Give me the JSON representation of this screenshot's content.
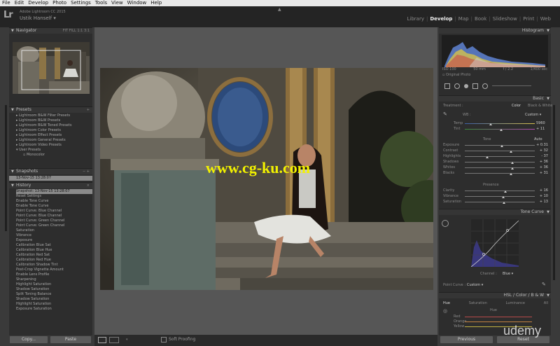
{
  "menu": [
    "File",
    "Edit",
    "Develop",
    "Photo",
    "Settings",
    "Tools",
    "View",
    "Window",
    "Help"
  ],
  "identity": {
    "logo": "Lr",
    "product": "Adobe Lightroom CC 2015",
    "user": "Ustik Hanself"
  },
  "modules": [
    "Library",
    "Develop",
    "Map",
    "Book",
    "Slideshow",
    "Print",
    "Web"
  ],
  "active_module": "Develop",
  "navigator": {
    "title": "Navigator",
    "zoom_opts": [
      "FIT",
      "FILL",
      "1:1",
      "3:1"
    ]
  },
  "presets": {
    "title": "Presets",
    "items": [
      "Lightroom B&W Filter Presets",
      "Lightroom B&W Presets",
      "Lightroom B&W Toned Presets",
      "Lightroom Color Presets",
      "Lightroom Effect Presets",
      "Lightroom General Presets",
      "Lightroom Video Presets",
      "User Presets"
    ],
    "sub": "Monocolor"
  },
  "snapshots": {
    "title": "Snapshots",
    "item": "13-Nov-15 13:28:07"
  },
  "history": {
    "title": "History",
    "items": [
      {
        "label": "Snapshot: 13-Nov-15 13:28:07",
        "val": ""
      },
      {
        "label": "Reset Settings",
        "val": ""
      },
      {
        "label": "Enable Tone Curve",
        "val": ""
      },
      {
        "label": "Enable Tone Curve",
        "val": ""
      },
      {
        "label": "Point Curve: Blue Channel",
        "val": ""
      },
      {
        "label": "Point Curve: Blue Channel",
        "val": ""
      },
      {
        "label": "Point Curve: Green Channel",
        "val": ""
      },
      {
        "label": "Point Curve: Green Channel",
        "val": ""
      },
      {
        "label": "Saturation",
        "val": ""
      },
      {
        "label": "Vibrance",
        "val": ""
      },
      {
        "label": "Exposure",
        "val": ""
      },
      {
        "label": "Calibration Blue Sat",
        "val": ""
      },
      {
        "label": "Calibration Blue Hue",
        "val": ""
      },
      {
        "label": "Calibration Red Sat",
        "val": ""
      },
      {
        "label": "Calibration Red Hue",
        "val": ""
      },
      {
        "label": "Calibration Shadow Tint",
        "val": ""
      },
      {
        "label": "Post-Crop Vignette Amount",
        "val": ""
      },
      {
        "label": "Enable Lens Profile",
        "val": ""
      },
      {
        "label": "Sharpening",
        "val": ""
      },
      {
        "label": "Highlight Saturation",
        "val": ""
      },
      {
        "label": "Shadow Saturation",
        "val": ""
      },
      {
        "label": "Split Toning Balance",
        "val": ""
      },
      {
        "label": "Shadow Saturation",
        "val": ""
      },
      {
        "label": "Highlight Saturation",
        "val": ""
      },
      {
        "label": "Exposure Saturation",
        "val": ""
      }
    ]
  },
  "left_buttons": {
    "copy": "Copy...",
    "paste": "Paste"
  },
  "watermark": "www.cg-ku.com",
  "toolbar": {
    "soft_proofing": "Soft Proofing"
  },
  "histogram": {
    "title": "Histogram",
    "iso": "ISO 100",
    "focal": "50 mm",
    "aperture": "f / 2.2",
    "shutter": "1/400 sec",
    "original_photo": "Original Photo"
  },
  "basic": {
    "title": "Basic",
    "treatment_label": "Treatment :",
    "color": "Color",
    "bw": "Black & White",
    "wb_label": "WB :",
    "wb_value": "Custom",
    "temp_label": "Temp",
    "temp_val": "5960",
    "tint_label": "Tint",
    "tint_val": "+ 11",
    "tone": "Tone",
    "auto": "Auto",
    "sliders": [
      {
        "label": "Exposure",
        "val": "+ 0.31"
      },
      {
        "label": "Contrast",
        "val": "+ 32"
      },
      {
        "label": "Highlights",
        "val": "- 37"
      },
      {
        "label": "Shadows",
        "val": "+ 36"
      },
      {
        "label": "Whites",
        "val": "+ 36"
      },
      {
        "label": "Blacks",
        "val": "+ 31"
      }
    ],
    "presence": "Presence",
    "presence_sliders": [
      {
        "label": "Clarity",
        "val": "+ 16"
      },
      {
        "label": "Vibrance",
        "val": "+ 10"
      },
      {
        "label": "Saturation",
        "val": "+ 13"
      }
    ]
  },
  "tone_curve": {
    "title": "Tone Curve",
    "channel_label": "Channel :",
    "channel": "Blue",
    "point_curve_label": "Point Curve :",
    "point_curve": "Custom"
  },
  "hsl": {
    "title": "HSL / Color / B & W",
    "tabs": [
      "Hue",
      "Saturation",
      "Luminance",
      "All"
    ],
    "sub_title": "Hue",
    "rows": [
      "Red",
      "Orange",
      "Yellow"
    ]
  },
  "right_buttons": {
    "previous": "Previous",
    "reset": "Reset"
  },
  "brand": "udemy"
}
